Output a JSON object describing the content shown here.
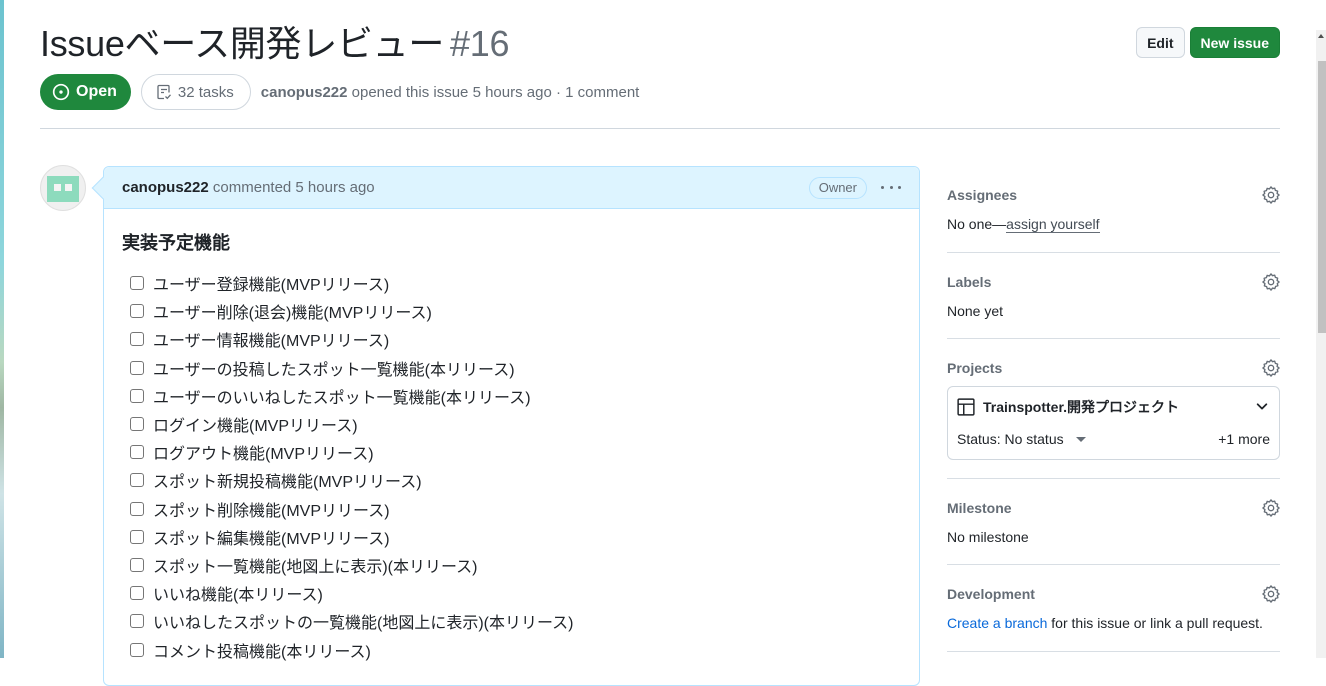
{
  "issue": {
    "title": "Issueベース開発レビュー",
    "number": "#16",
    "state": "Open",
    "tasks": "32 tasks",
    "author": "canopus222",
    "opened_text": "opened this issue 5 hours ago · 1 comment"
  },
  "header_actions": {
    "edit_label": "Edit",
    "new_issue_label": "New issue"
  },
  "comment": {
    "author": "canopus222",
    "meta": "commented 5 hours ago",
    "role_badge": "Owner",
    "heading": "実装予定機能",
    "tasks": [
      "ユーザー登録機能(MVPリリース)",
      "ユーザー削除(退会)機能(MVPリリース)",
      "ユーザー情報機能(MVPリリース)",
      "ユーザーの投稿したスポット一覧機能(本リリース)",
      "ユーザーのいいねしたスポット一覧機能(本リリース)",
      "ログイン機能(MVPリリース)",
      "ログアウト機能(MVPリリース)",
      "スポット新規投稿機能(MVPリリース)",
      "スポット削除機能(MVPリリース)",
      "スポット編集機能(MVPリリース)",
      "スポット一覧機能(地図上に表示)(本リリース)",
      "いいね機能(本リリース)",
      "いいねしたスポットの一覧機能(地図上に表示)(本リリース)",
      "コメント投稿機能(本リリース)"
    ]
  },
  "sidebar": {
    "assignees": {
      "title": "Assignees",
      "value_prefix": "No one—",
      "value_link": "assign yourself"
    },
    "labels": {
      "title": "Labels",
      "value": "None yet"
    },
    "projects": {
      "title": "Projects",
      "project_name": "Trainspotter.開発プロジェクト",
      "status": "Status: No status",
      "more": "+1 more"
    },
    "milestone": {
      "title": "Milestone",
      "value": "No milestone"
    },
    "development": {
      "title": "Development",
      "link": "Create a branch",
      "rest": " for this issue or link a pull request."
    }
  },
  "colors": {
    "open_green": "#1f883d",
    "comment_header_bg": "#ddf4ff",
    "comment_border": "#b6e3ff",
    "link_blue": "#0969da",
    "muted": "#656d76"
  }
}
